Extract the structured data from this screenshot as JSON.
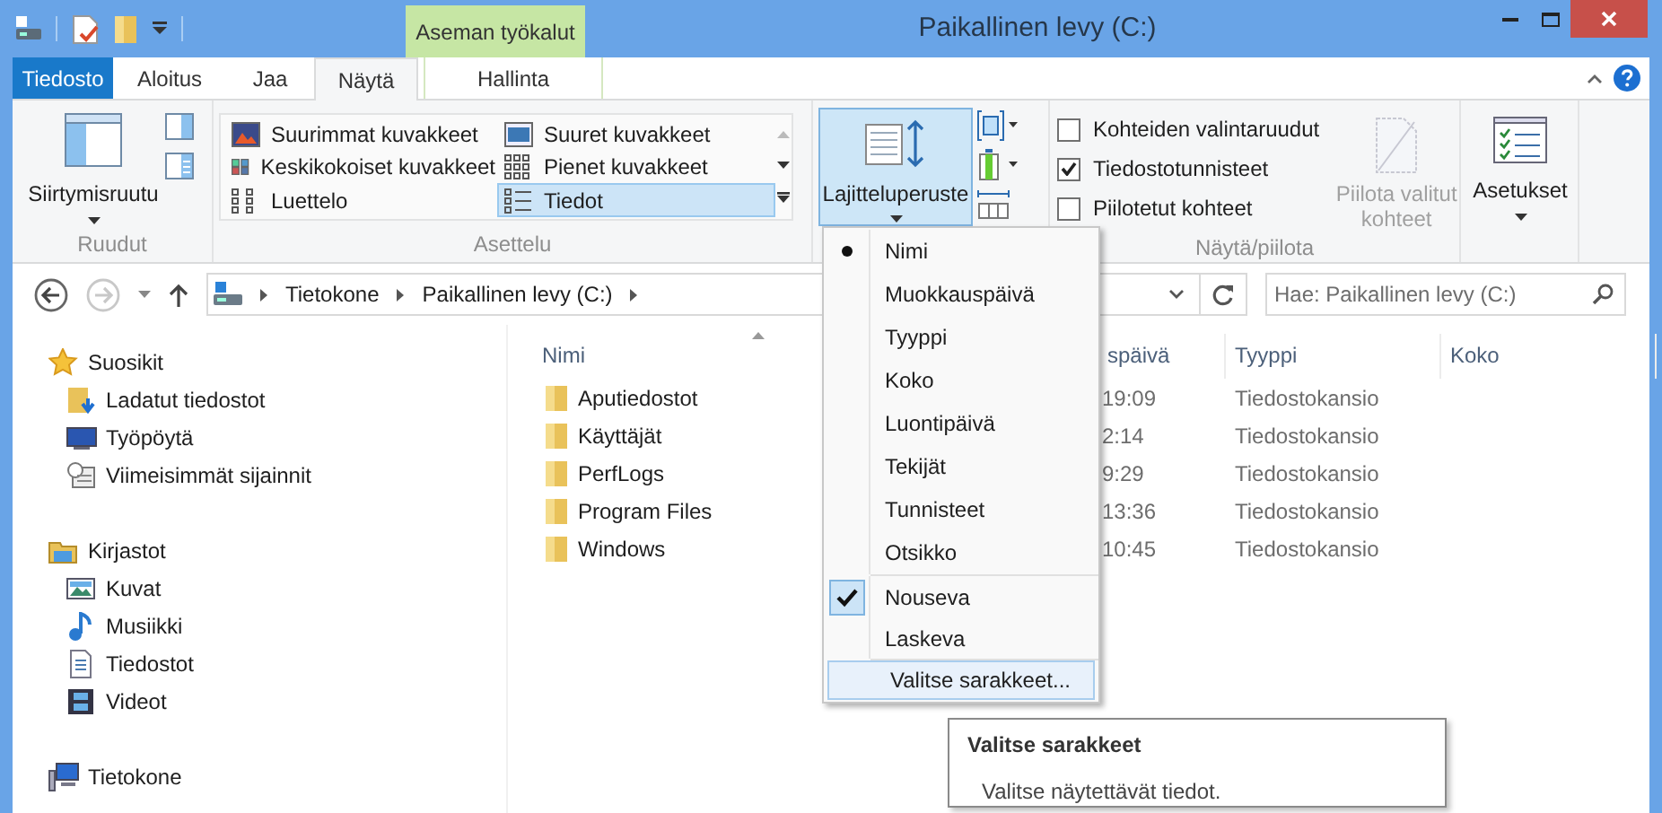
{
  "window": {
    "title": "Paikallinen levy (C:)",
    "context_tab_group": "Aseman työkalut"
  },
  "tabs": [
    {
      "label": "Tiedosto",
      "kind": "file",
      "selected": false
    },
    {
      "label": "Aloitus",
      "kind": "normal",
      "selected": false
    },
    {
      "label": "Jaa",
      "kind": "normal",
      "selected": false
    },
    {
      "label": "Näytä",
      "kind": "normal",
      "selected": true
    },
    {
      "label": "Hallinta",
      "kind": "context",
      "selected": false
    }
  ],
  "ribbon": {
    "panes": {
      "label": "Ruudut",
      "button": "Siirtymisruutu"
    },
    "layout": {
      "label": "Asettelu",
      "items": [
        {
          "label": "Suurimmat kuvakkeet",
          "kind": "extra-large",
          "selected": false
        },
        {
          "label": "Suuret kuvakkeet",
          "kind": "large",
          "selected": false
        },
        {
          "label": "Keskikokoiset kuvakkeet",
          "kind": "medium",
          "selected": false
        },
        {
          "label": "Pienet kuvakkeet",
          "kind": "small",
          "selected": false
        },
        {
          "label": "Luettelo",
          "kind": "list",
          "selected": false
        },
        {
          "label": "Tiedot",
          "kind": "details",
          "selected": true
        }
      ]
    },
    "current_view": {
      "button": "Lajitteluperuste",
      "expanded": true
    },
    "show_hide": {
      "label": "Näytä/piilota",
      "checkboxes": [
        {
          "label": "Kohteiden valintaruudut",
          "checked": false
        },
        {
          "label": "Tiedostotunnisteet",
          "checked": true
        },
        {
          "label": "Piilotetut kohteet",
          "checked": false
        }
      ],
      "hide_selected": {
        "label": "Piilota valitut kohteet",
        "disabled": true
      }
    },
    "options": {
      "button": "Asetukset"
    }
  },
  "address_bar": {
    "forward_disabled": true,
    "breadcrumb": [
      "Tietokone",
      "Paikallinen levy (C:)"
    ],
    "search": {
      "placeholder": "Hae: Paikallinen levy (C:)"
    }
  },
  "navigation": [
    {
      "label": "Suosikit",
      "kind": "favorites",
      "selected": false,
      "children": [
        {
          "label": "Ladatut tiedostot",
          "kind": "downloads",
          "selected": false
        },
        {
          "label": "Työpöytä",
          "kind": "desktop",
          "selected": false
        },
        {
          "label": "Viimeisimmät sijainnit",
          "kind": "recent",
          "selected": false
        }
      ]
    },
    {
      "label": "Kirjastot",
      "kind": "libraries",
      "selected": false,
      "children": [
        {
          "label": "Kuvat",
          "kind": "pictures",
          "selected": false
        },
        {
          "label": "Musiikki",
          "kind": "music",
          "selected": false
        },
        {
          "label": "Tiedostot",
          "kind": "documents",
          "selected": false
        },
        {
          "label": "Videot",
          "kind": "videos",
          "selected": false
        }
      ]
    },
    {
      "label": "Tietokone",
      "kind": "computer",
      "selected": false
    }
  ],
  "file_list": {
    "columns": [
      {
        "label": "Nimi",
        "sorted": true
      },
      {
        "label": "späivä",
        "sorted": false
      },
      {
        "label": "Tyyppi",
        "sorted": false
      },
      {
        "label": "Koko",
        "sorted": false
      }
    ],
    "rows": [
      {
        "name": "Aputiedostot",
        "modified": "19:09",
        "type": "Tiedostokansio"
      },
      {
        "name": "Käyttäjät",
        "modified": "2:14",
        "type": "Tiedostokansio"
      },
      {
        "name": "PerfLogs",
        "modified": "9:29",
        "type": "Tiedostokansio"
      },
      {
        "name": "Program Files",
        "modified": "13:36",
        "type": "Tiedostokansio"
      },
      {
        "name": "Windows",
        "modified": "10:45",
        "type": "Tiedostokansio"
      }
    ]
  },
  "sort_menu": {
    "items": [
      {
        "label": "Nimi",
        "kind": "field",
        "selected": true,
        "highlighted": false
      },
      {
        "label": "Muokkauspäivä",
        "kind": "field",
        "selected": false,
        "highlighted": false
      },
      {
        "label": "Tyyppi",
        "kind": "field",
        "selected": false,
        "highlighted": false
      },
      {
        "label": "Koko",
        "kind": "field",
        "selected": false,
        "highlighted": false
      },
      {
        "label": "Luontipäivä",
        "kind": "field",
        "selected": false,
        "highlighted": false
      },
      {
        "label": "Tekijät",
        "kind": "field",
        "selected": false,
        "highlighted": false
      },
      {
        "label": "Tunnisteet",
        "kind": "field",
        "selected": false,
        "highlighted": false
      },
      {
        "label": "Otsikko",
        "kind": "field",
        "selected": false,
        "highlighted": false
      },
      {
        "label": "Nouseva",
        "kind": "order",
        "selected": true,
        "highlighted": false
      },
      {
        "label": "Laskeva",
        "kind": "order",
        "selected": false,
        "highlighted": false
      },
      {
        "label": "Valitse sarakkeet...",
        "kind": "command",
        "highlighted": true
      }
    ]
  },
  "tooltip": {
    "title": "Valitse sarakkeet",
    "text": "Valitse näytettävät tiedot."
  }
}
